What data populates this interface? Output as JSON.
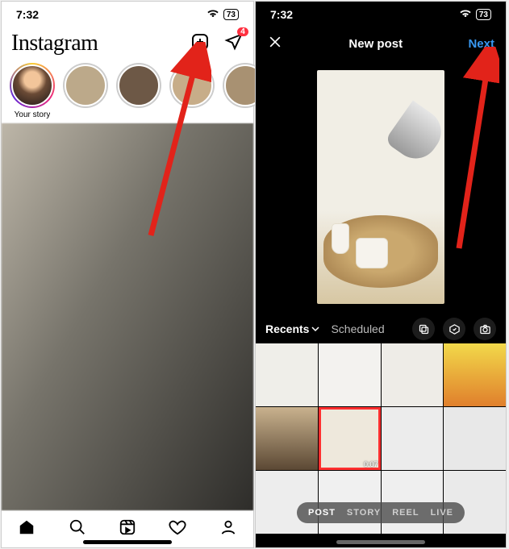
{
  "status": {
    "time": "7:32",
    "battery": "73"
  },
  "left": {
    "logo": "Instagram",
    "dm_badge": "4",
    "story_your_label": "Your story",
    "nav": {
      "home": "home",
      "search": "search",
      "reels": "reels",
      "activity": "activity",
      "profile": "profile"
    }
  },
  "right": {
    "title": "New post",
    "next": "Next",
    "source_primary": "Recents",
    "source_secondary": "Scheduled",
    "modes": {
      "post": "POST",
      "story": "STORY",
      "reel": "REEL",
      "live": "LIVE"
    },
    "selected_duration": "0:07"
  }
}
